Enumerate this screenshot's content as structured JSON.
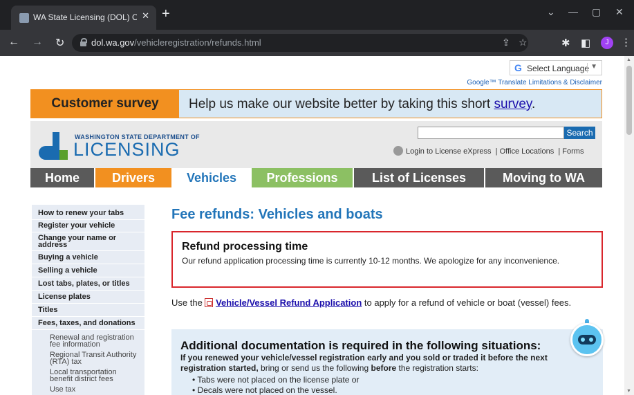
{
  "browser": {
    "tab_title": "WA State Licensing (DOL) Official",
    "url_domain": "dol.wa.gov",
    "url_path": "/vehicleregistration/refunds.html",
    "profile_initial": "J"
  },
  "translate": {
    "label": "Select Language",
    "disclaimer": "Google™ Translate Limitations & Disclaimer"
  },
  "survey": {
    "label": "Customer survey",
    "text": "Help us make our website better by taking this short",
    "link": "survey",
    "suffix": "."
  },
  "header": {
    "logo_top": "WASHINGTON STATE DEPARTMENT OF",
    "logo_main": "LICENSING",
    "search_button": "Search",
    "links": [
      "Login to License eXpress",
      "Office Locations",
      "Forms"
    ]
  },
  "nav": [
    {
      "label": "Home",
      "color": "#5a5a5a"
    },
    {
      "label": "Drivers",
      "color": "#f29020"
    },
    {
      "label": "Vehicles",
      "color": "#ffffff"
    },
    {
      "label": "Professions",
      "color": "#8cc063"
    },
    {
      "label": "List of Licenses",
      "color": "#5a5a5a"
    },
    {
      "label": "Moving to WA",
      "color": "#5a5a5a"
    }
  ],
  "sidebar": {
    "items": [
      "How to renew your tabs",
      "Register your vehicle",
      "Change your name or address",
      "Buying a vehicle",
      "Selling a vehicle",
      "Lost tabs, plates, or titles",
      "License plates",
      "Titles",
      "Fees, taxes, and donations"
    ],
    "subitems": [
      "Renewal and registration fee information",
      "Regional Transit Authority (RTA) tax",
      "Local transportation benefit district fees",
      "Use tax"
    ]
  },
  "main": {
    "title": "Fee refunds: Vehicles and boats",
    "notice_title": "Refund processing time",
    "notice_body": "Our refund application processing time is currently 10-12 months. We apologize for any inconvenience.",
    "use_prefix": "Use the",
    "app_link": "Vehicle/Vessel Refund Application",
    "use_suffix": "to apply for a refund of vehicle or boat (vessel) fees.",
    "doc_heading": "Additional documentation is required in the following situations:",
    "doc_bold1": "If you renewed your vehicle/vessel registration early and you sold or traded it before the next registration started,",
    "doc_mid": "bring or send us the following",
    "doc_bold2": "before",
    "doc_end": "the registration starts:",
    "doc_list": [
      "Tabs were not placed on the license plate or",
      "Decals were not placed on the vessel."
    ]
  }
}
